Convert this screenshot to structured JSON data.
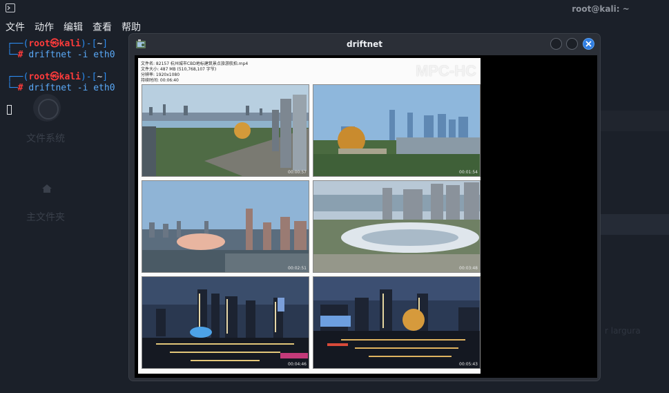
{
  "terminal": {
    "title": "root@kali: ~",
    "menu": [
      "文件",
      "动作",
      "编辑",
      "查看",
      "帮助"
    ],
    "prompts": [
      {
        "user": "root",
        "at": "㉿",
        "host": "kali",
        "dir": "~",
        "hash": "#",
        "command": "driftnet -i eth0"
      },
      {
        "user": "root",
        "at": "㉿",
        "host": "kali",
        "dir": "~",
        "hash": "#",
        "command": "driftnet -i eth0"
      }
    ]
  },
  "desktop": {
    "icon1_label": "文件系统",
    "icon2_label": "主文件夹",
    "right_text": "r largura"
  },
  "driftnet": {
    "title": "driftnet",
    "capture": {
      "info": [
        "文件名: 82157 杭州城市CBD地标建筑景点旅游航拍.mp4",
        "文件大小: 487 MB (510,768,107 字节)",
        "分辨率: 1920x1080",
        "持续时间: 00:06:40"
      ],
      "logo": "MPC-HC",
      "thumbnails": [
        {
          "time": "00:00:57",
          "scene": "day-river-skyline"
        },
        {
          "time": "00:01:54",
          "scene": "day-golden-sphere"
        },
        {
          "time": "00:02:51",
          "scene": "dusk-stadium"
        },
        {
          "time": "00:03:48",
          "scene": "day-stadium-white"
        },
        {
          "time": "00:04:46",
          "scene": "night-skyline"
        },
        {
          "time": "00:05:43",
          "scene": "night-golden-sphere"
        }
      ]
    }
  },
  "colors": {
    "prompt_blue": "#2d8cf0",
    "prompt_red": "#ff3b3b",
    "close_button": "#2f7de1"
  }
}
